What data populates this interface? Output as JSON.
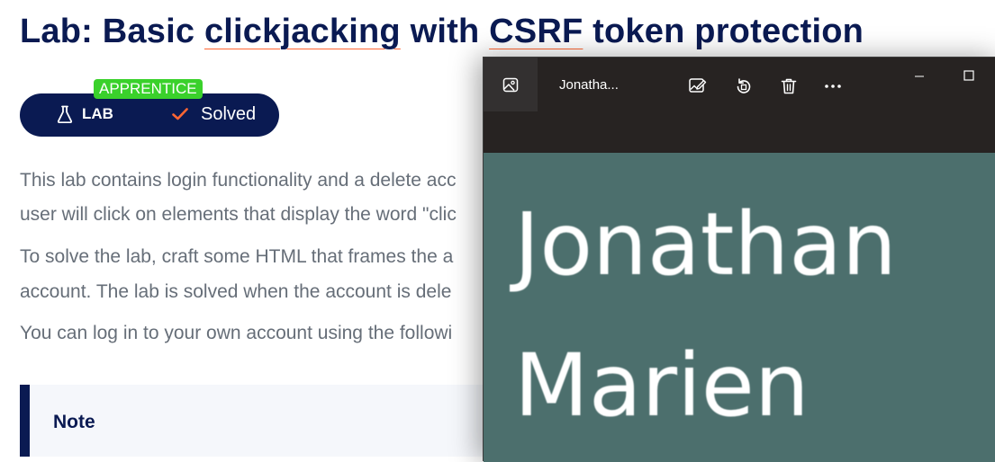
{
  "lab": {
    "title_words": [
      "Lab:",
      "Basic",
      "clickjacking",
      "with",
      "CSRF",
      "token",
      "protection"
    ],
    "level_badge": "APPRENTICE",
    "tag_label": "LAB",
    "status_label": "Solved",
    "paragraphs": [
      "This lab contains login functionality and a delete acc",
      "user will click on elements that display the word \"clic",
      "To solve the lab, craft some HTML that frames the a",
      "account. The lab is solved when the account is dele",
      "You can log in to your own account using the followi"
    ],
    "note_title": "Note"
  },
  "photo_viewer": {
    "window_title": "Jonatha...",
    "photo_lines": [
      "Jonathan",
      "Marien"
    ],
    "toolbar_icons": [
      "gallery-icon",
      "edit-image-icon",
      "rotate-icon",
      "delete-icon",
      "more-icon"
    ],
    "window_controls": [
      "minimize-icon",
      "maximize-icon"
    ]
  },
  "colors": {
    "navy": "#0a1a52",
    "apprentice_green": "#3ad12b",
    "check_orange": "#ff6633",
    "body_text": "#666e78",
    "photo_bg": "#4c6f6d",
    "viewer_bg": "#272322"
  }
}
